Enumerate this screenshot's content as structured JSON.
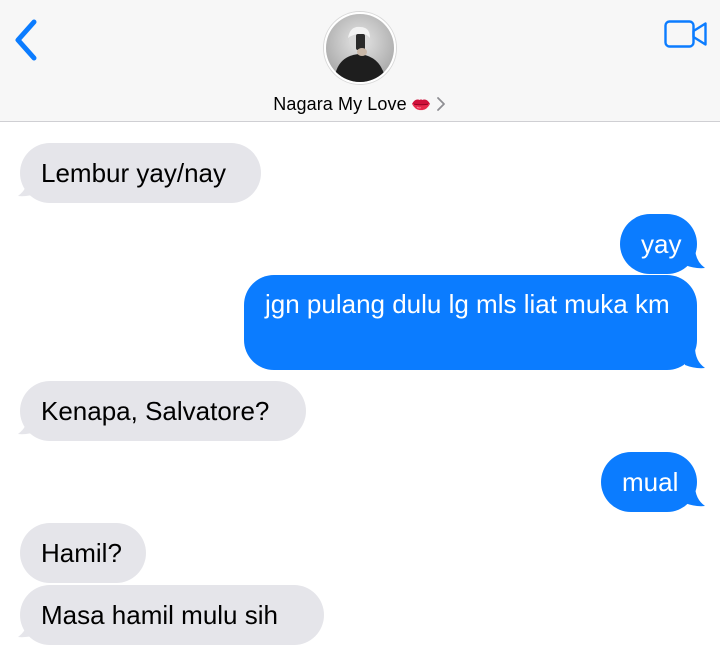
{
  "header": {
    "contact_name": "Nagara My Love",
    "name_emoji": "kiss-mark-icon",
    "back_icon": "chevron-left-icon",
    "video_icon": "video-camera-icon",
    "accent_color": "#0b7cff"
  },
  "messages": [
    {
      "direction": "incoming",
      "text": "Lembur yay/nay"
    },
    {
      "direction": "outgoing",
      "text": "yay"
    },
    {
      "direction": "outgoing",
      "text": "jgn pulang dulu lg mls liat muka km"
    },
    {
      "direction": "incoming",
      "text": "Kenapa, Salvatore?"
    },
    {
      "direction": "outgoing",
      "text": "mual"
    },
    {
      "direction": "incoming",
      "text": "Hamil?"
    },
    {
      "direction": "incoming",
      "text": "Masa hamil mulu sih"
    }
  ]
}
